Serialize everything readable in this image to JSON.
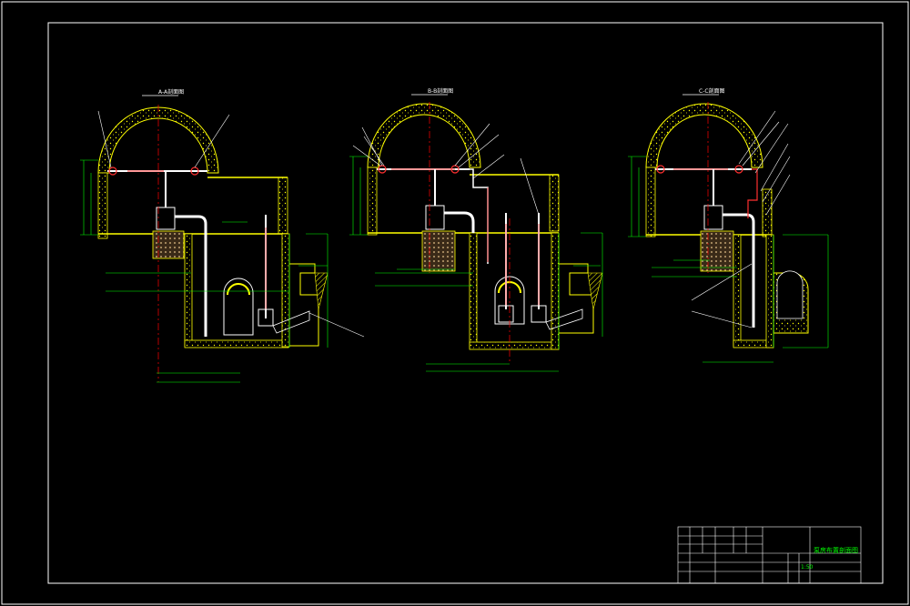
{
  "drawing": {
    "sections": [
      {
        "title": "A-A剖面图"
      },
      {
        "title": "B-B剖面图"
      },
      {
        "title": "C-C剖面图"
      }
    ],
    "title_block": {
      "drawing_title": "泵房布置剖面图",
      "scale": "1:50"
    }
  },
  "colors": {
    "background": "#000000",
    "frame": "#ffffff",
    "wall": "#ffff00",
    "pipe": "#ffffff",
    "pipe_red": "#ff3030",
    "center_line": "#ff0000",
    "dimension": "#00ff00",
    "leader": "#ffffff",
    "label": "#0080ff",
    "rock_fill": "#a08060"
  }
}
